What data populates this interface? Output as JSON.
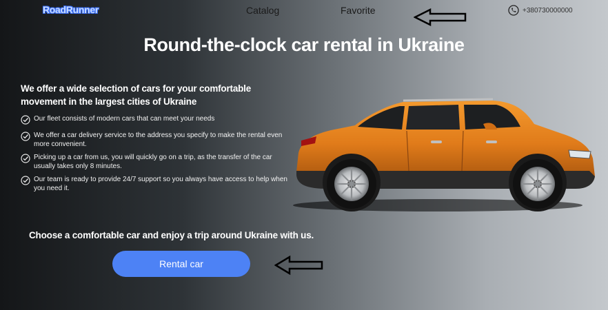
{
  "header": {
    "logo": "RoadRunner",
    "nav": {
      "catalog": "Catalog",
      "favorite": "Favorite"
    },
    "phone": "+380730000000",
    "phone_icon": "phone-icon"
  },
  "hero": {
    "title": "Round-the-clock car rental in Ukraine",
    "subheading": "We offer a wide selection of cars for your comfortable movement in the largest cities of Ukraine",
    "features": [
      "Our fleet consists of modern cars that can meet your needs",
      "We offer a car delivery service to the address you specify to make the rental even more convenient.",
      "Picking up a car from us, you will quickly go on a trip, as the transfer of the car usually takes only 8 minutes.",
      "Our team is ready to provide 24/7 support so you always have access to help when you need it."
    ],
    "feature_icon": "check-circle-icon",
    "tagline": "Choose a comfortable car and enjoy a trip around Ukraine with us.",
    "cta_label": "Rental car"
  },
  "colors": {
    "accent": "#4d82f5",
    "car_body": "#e07b1a"
  }
}
